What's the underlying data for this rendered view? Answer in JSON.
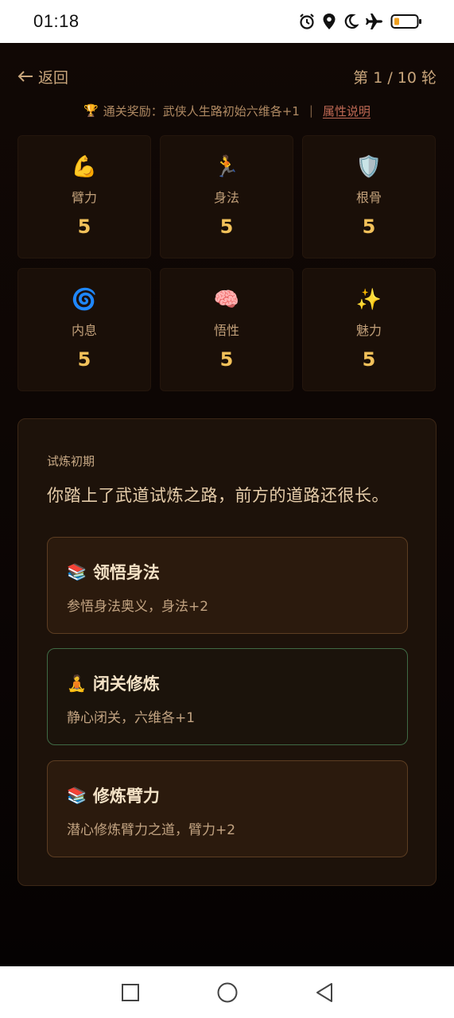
{
  "status_bar": {
    "time": "01:18",
    "icons": [
      "alarm-icon",
      "location-icon",
      "moon-icon",
      "airplane-icon",
      "battery-icon"
    ],
    "battery_accent": "#f0a020"
  },
  "header": {
    "back_label": "返回",
    "round_label": "第 1 / 10 轮"
  },
  "reward": {
    "text": "通关奖励：武侠人生路初始六维各+1",
    "separator": "|",
    "link_label": "属性说明"
  },
  "stats": [
    {
      "icon": "💪",
      "name": "臂力",
      "value": "5"
    },
    {
      "icon": "🏃",
      "name": "身法",
      "value": "5"
    },
    {
      "icon": "🛡️",
      "name": "根骨",
      "value": "5"
    },
    {
      "icon": "🌀",
      "name": "内息",
      "value": "5"
    },
    {
      "icon": "🧠",
      "name": "悟性",
      "value": "5"
    },
    {
      "icon": "✨",
      "name": "魅力",
      "value": "5"
    }
  ],
  "event": {
    "phase": "试炼初期",
    "description": "你踏上了武道试炼之路，前方的道路还很长。",
    "choices": [
      {
        "icon": "📚",
        "title": "领悟身法",
        "desc": "参悟身法奥义，身法+2"
      },
      {
        "icon": "🧘",
        "title": "闭关修炼",
        "desc": "静心闭关，六维各+1"
      },
      {
        "icon": "📚",
        "title": "修炼臂力",
        "desc": "潜心修炼臂力之道，臂力+2"
      }
    ]
  },
  "colors": {
    "accent_gold": "#f2c15a",
    "text_tan": "#c9a67c",
    "link_red": "#c06a55",
    "highlight_green": "#3f6a45"
  }
}
